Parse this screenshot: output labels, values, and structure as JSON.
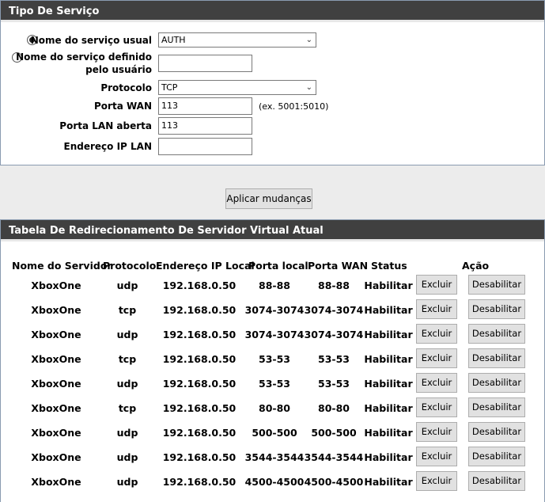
{
  "service": {
    "title": "Tipo De Serviço",
    "usual_label": "Nome do serviço usual",
    "usual_value": "AUTH",
    "custom_label_line1": "Nome do serviço definido",
    "custom_label_line2": "pelo usuário",
    "custom_value": "",
    "protocol_label": "Protocolo",
    "protocol_value": "TCP",
    "wan_port_label": "Porta WAN",
    "wan_port_value": "113",
    "wan_port_hint": "(ex. 5001:5010)",
    "lan_port_label": "Porta LAN aberta",
    "lan_port_value": "113",
    "lan_ip_label": "Endereço IP LAN",
    "lan_ip_value": ""
  },
  "apply_label": "Aplicar mudanças",
  "table": {
    "title": "Tabela De Redirecionamento De Servidor Virtual Atual",
    "headers": {
      "server": "Nome do Servidor",
      "protocol": "Protocolo",
      "ip": "Endereço IP Local",
      "local_port": "Porta local",
      "wan_port": "Porta WAN",
      "status": "Status",
      "action": "Ação"
    },
    "delete_label": "Excluir",
    "disable_label": "Desabilitar",
    "rows": [
      {
        "server": "XboxOne",
        "protocol": "udp",
        "ip": "192.168.0.50",
        "local_port": "88-88",
        "wan_port": "88-88",
        "status": "Habilitar"
      },
      {
        "server": "XboxOne",
        "protocol": "tcp",
        "ip": "192.168.0.50",
        "local_port": "3074-3074",
        "wan_port": "3074-3074",
        "status": "Habilitar"
      },
      {
        "server": "XboxOne",
        "protocol": "udp",
        "ip": "192.168.0.50",
        "local_port": "3074-3074",
        "wan_port": "3074-3074",
        "status": "Habilitar"
      },
      {
        "server": "XboxOne",
        "protocol": "tcp",
        "ip": "192.168.0.50",
        "local_port": "53-53",
        "wan_port": "53-53",
        "status": "Habilitar"
      },
      {
        "server": "XboxOne",
        "protocol": "udp",
        "ip": "192.168.0.50",
        "local_port": "53-53",
        "wan_port": "53-53",
        "status": "Habilitar"
      },
      {
        "server": "XboxOne",
        "protocol": "tcp",
        "ip": "192.168.0.50",
        "local_port": "80-80",
        "wan_port": "80-80",
        "status": "Habilitar"
      },
      {
        "server": "XboxOne",
        "protocol": "udp",
        "ip": "192.168.0.50",
        "local_port": "500-500",
        "wan_port": "500-500",
        "status": "Habilitar"
      },
      {
        "server": "XboxOne",
        "protocol": "udp",
        "ip": "192.168.0.50",
        "local_port": "3544-3544",
        "wan_port": "3544-3544",
        "status": "Habilitar"
      },
      {
        "server": "XboxOne",
        "protocol": "udp",
        "ip": "192.168.0.50",
        "local_port": "4500-4500",
        "wan_port": "4500-4500",
        "status": "Habilitar"
      }
    ]
  }
}
